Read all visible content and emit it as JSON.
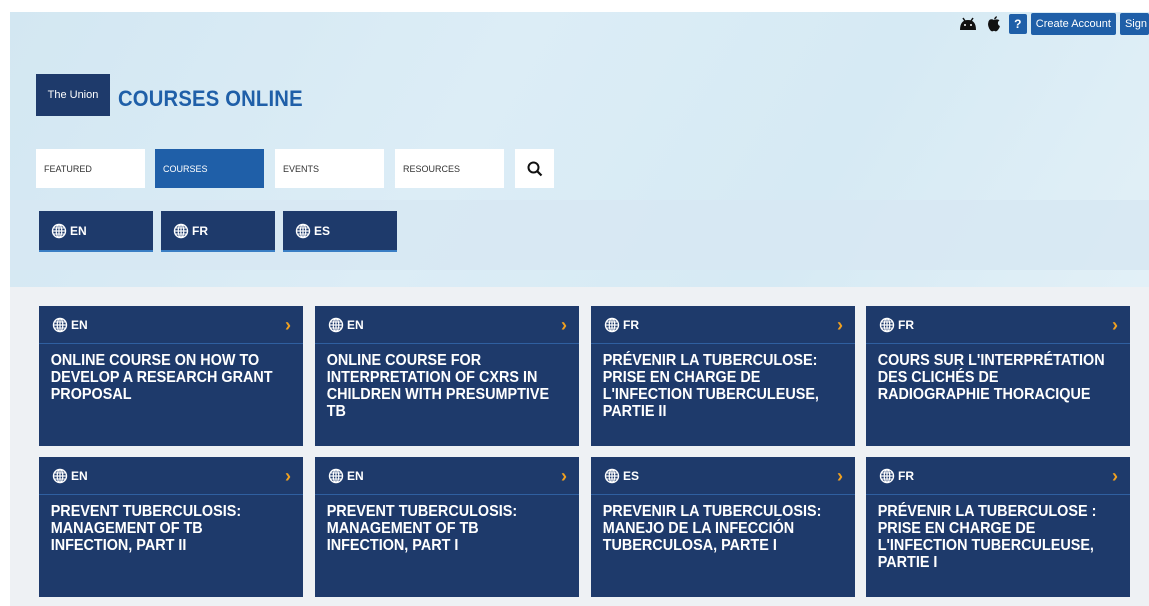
{
  "colors": {
    "navy": "#1e3a6b",
    "accent_blue": "#1f5fa8",
    "chevron": "#f0a020",
    "hero_bg": "#d8ebf5"
  },
  "topbar": {
    "android_icon": "android-icon",
    "apple_icon": "apple-icon",
    "help_label": "?",
    "create_account_label": "Create Account",
    "sign_in_label": "Sign"
  },
  "header": {
    "logo_text": "The Union",
    "title": "COURSES ONLINE"
  },
  "nav": {
    "items": [
      {
        "label": "FEATURED"
      },
      {
        "label": "COURSES",
        "active": true
      },
      {
        "label": "EVENTS"
      },
      {
        "label": "RESOURCES"
      }
    ],
    "search_icon": "search-icon"
  },
  "languages": [
    {
      "code": "EN"
    },
    {
      "code": "FR"
    },
    {
      "code": "ES"
    }
  ],
  "cards": [
    {
      "lang": "EN",
      "title": "ONLINE COURSE ON HOW TO DEVELOP A RESEARCH GRANT PROPOSAL"
    },
    {
      "lang": "EN",
      "title": "ONLINE COURSE FOR INTERPRETATION OF CXRS IN CHILDREN WITH PRESUMPTIVE TB"
    },
    {
      "lang": "FR",
      "title": "PRÉVENIR LA TUBERCULOSE: PRISE EN CHARGE DE L'INFECTION TUBERCULEUSE, PARTIE II"
    },
    {
      "lang": "FR",
      "title": "COURS SUR L'INTERPRÉTATION DES CLICHÉS DE RADIOGRAPHIE THORACIQUE"
    },
    {
      "lang": "EN",
      "title": "PREVENT TUBERCULOSIS: MANAGEMENT OF TB INFECTION, PART II"
    },
    {
      "lang": "EN",
      "title": "PREVENT TUBERCULOSIS: MANAGEMENT OF TB INFECTION, PART I"
    },
    {
      "lang": "ES",
      "title": "PREVENIR LA TUBERCULOSIS: MANEJO DE LA INFECCIÓN TUBERCULOSA, PARTE I"
    },
    {
      "lang": "FR",
      "title": "PRÉVENIR LA TUBERCULOSE : PRISE EN CHARGE DE L'INFECTION TUBERCULEUSE, PARTIE I"
    }
  ]
}
